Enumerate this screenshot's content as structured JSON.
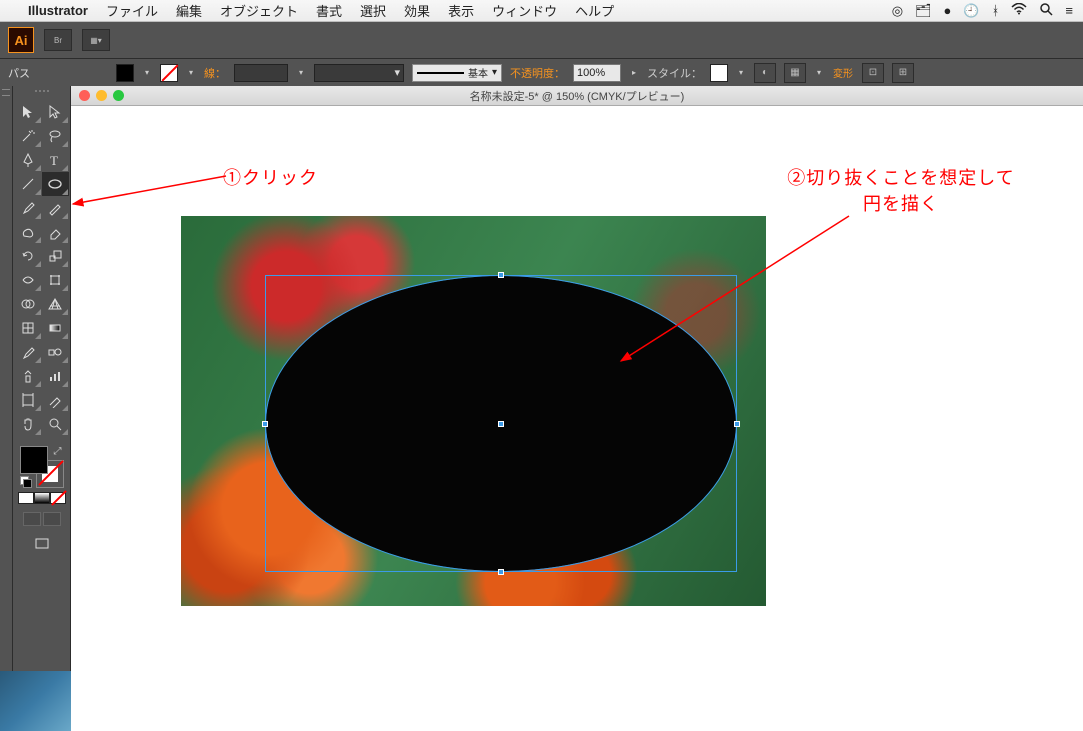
{
  "mac_menu": {
    "app_name": "Illustrator",
    "items": [
      "ファイル",
      "編集",
      "オブジェクト",
      "書式",
      "選択",
      "効果",
      "表示",
      "ウィンドウ",
      "ヘルプ"
    ]
  },
  "control_bar": {
    "selection_label": "パス",
    "stroke_label": "線：",
    "stroke_weight": "",
    "stroke_style_label": "基本",
    "opacity_label": "不透明度：",
    "opacity_value": "100%",
    "style_label": "スタイル：",
    "transform_label": "変形"
  },
  "document": {
    "title": "名称未設定-5* @ 150% (CMYK/プレビュー)"
  },
  "annotations": {
    "anno1": "①クリック",
    "anno2_line1": "②切り抜くことを想定して",
    "anno2_line2": "円を描く"
  }
}
